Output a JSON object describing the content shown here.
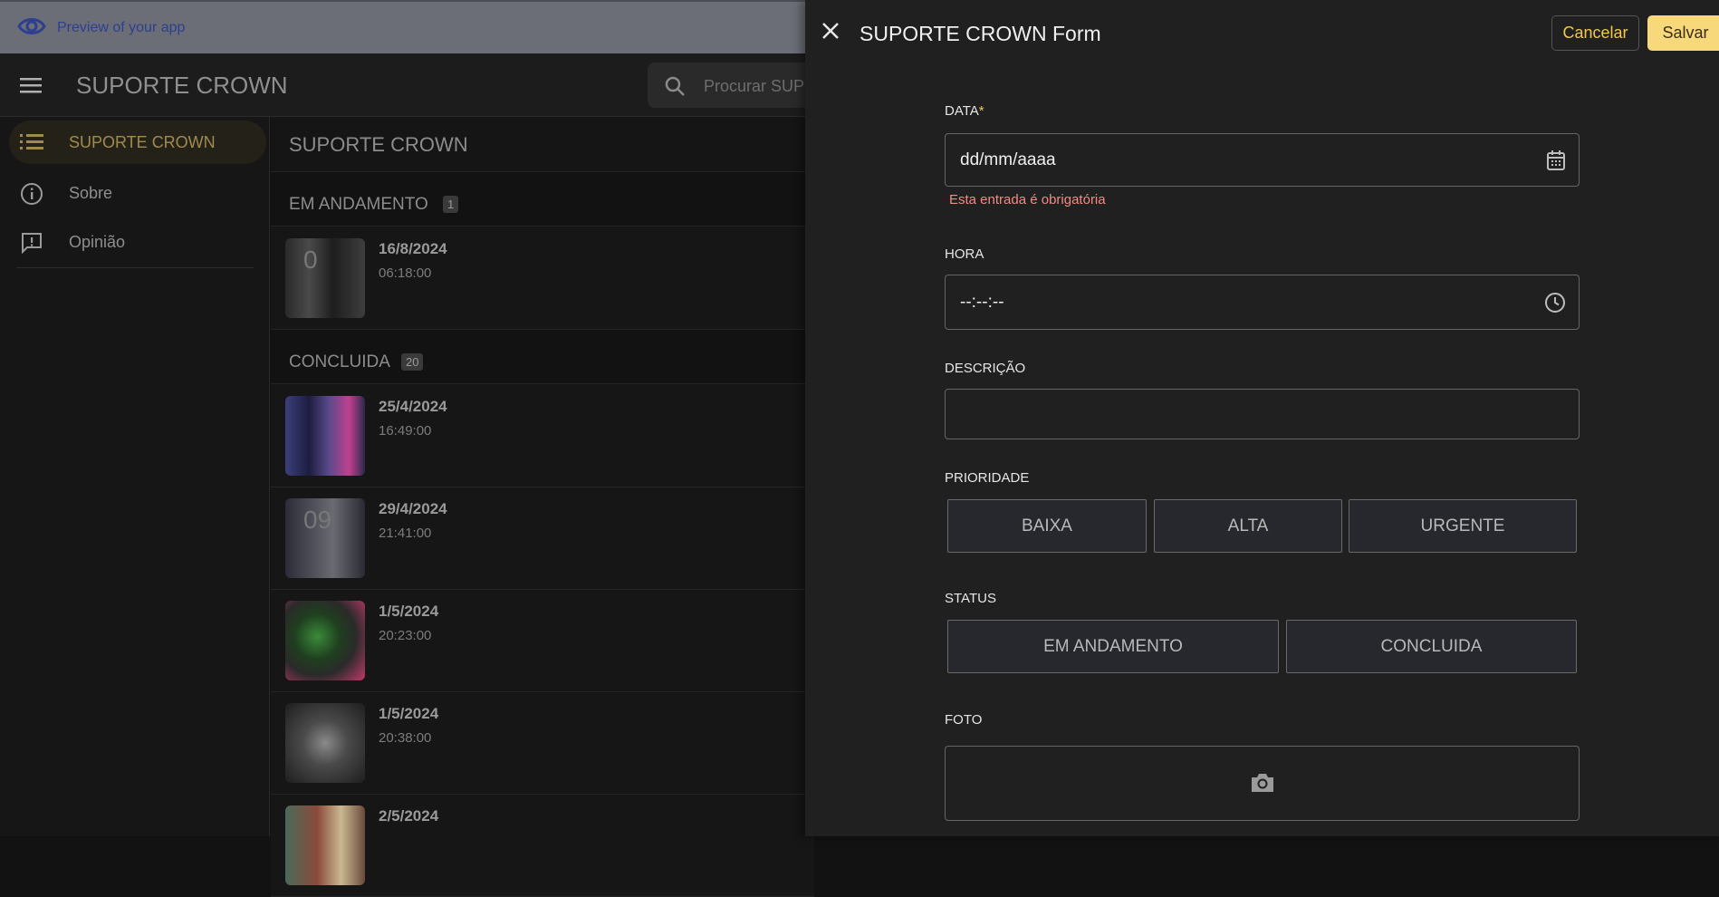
{
  "preview": {
    "text": "Preview of your app"
  },
  "header": {
    "title": "SUPORTE CROWN",
    "search_placeholder": "Procurar SUPORTE CROWN"
  },
  "sidebar": {
    "items": [
      {
        "label": "SUPORTE CROWN"
      },
      {
        "label": "Sobre"
      },
      {
        "label": "Opinião"
      }
    ]
  },
  "main": {
    "title": "SUPORTE CROWN",
    "groups": [
      {
        "label": "EM ANDAMENTO",
        "count": "1"
      },
      {
        "label": "CONCLUIDA",
        "count": "20"
      }
    ],
    "rows": [
      {
        "date": "16/8/2024",
        "time": "06:18:00",
        "thumb_text": "0"
      },
      {
        "date": "25/4/2024",
        "time": "16:49:00"
      },
      {
        "date": "29/4/2024",
        "time": "21:41:00",
        "thumb_text": "09"
      },
      {
        "date": "1/5/2024",
        "time": "20:23:00"
      },
      {
        "date": "1/5/2024",
        "time": "20:38:00"
      },
      {
        "date": "2/5/2024",
        "time": ""
      }
    ]
  },
  "form": {
    "title": "SUPORTE CROWN Form",
    "cancel_label": "Cancelar",
    "save_label": "Salvar",
    "data_label": "DATA",
    "data_required": "*",
    "data_value": "dd/mm/aaaa",
    "data_error": "Esta entrada é obrigatória",
    "hora_label": "HORA",
    "hora_value": "--:--:--",
    "descricao_label": "DESCRIÇÃO",
    "prioridade_label": "PRIORIDADE",
    "prioridade_options": [
      "BAIXA",
      "ALTA",
      "URGENTE"
    ],
    "status_label": "STATUS",
    "status_options": [
      "EM ANDAMENTO",
      "CONCLUIDA"
    ],
    "foto_label": "FOTO"
  },
  "colors": {
    "accent": "#f2c94c",
    "save_bg": "#f7d87a",
    "error": "#f28b82",
    "active_nav": "#a08a50"
  },
  "icons": [
    "eye-icon",
    "menu-icon",
    "search-icon",
    "list-icon",
    "info-icon",
    "feedback-icon",
    "close-icon",
    "calendar-icon",
    "clock-icon",
    "camera-icon"
  ]
}
